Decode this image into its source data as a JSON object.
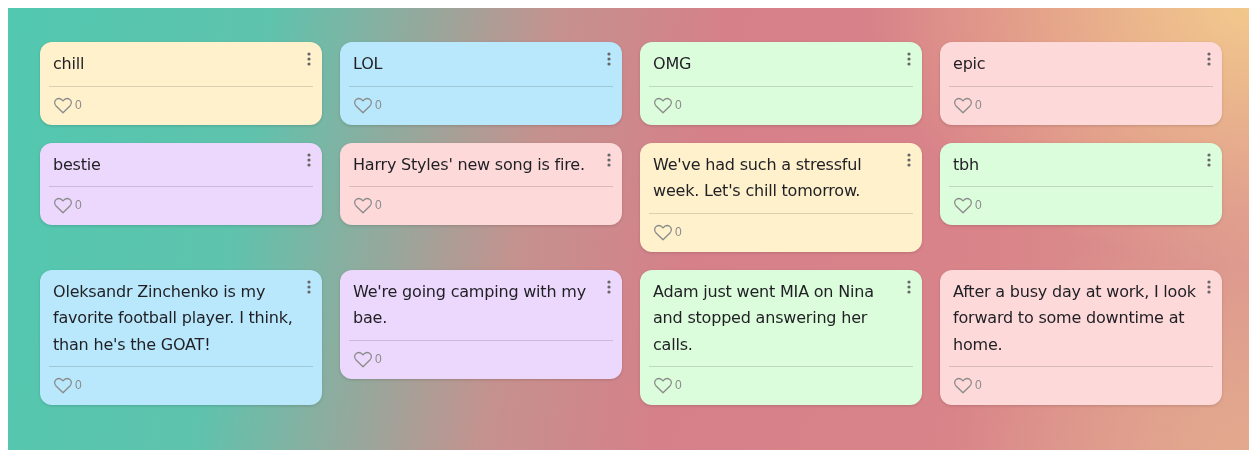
{
  "cards": [
    {
      "text": "chill",
      "color": "#fef1cc",
      "likes": "0"
    },
    {
      "text": "LOL",
      "color": "#b9e8fc",
      "likes": "0"
    },
    {
      "text": "OMG",
      "color": "#dcfddc",
      "likes": "0"
    },
    {
      "text": "epic",
      "color": "#fdd9da",
      "likes": "0"
    },
    {
      "text": "bestie",
      "color": "#edd8fd",
      "likes": "0"
    },
    {
      "text": "Harry Styles' new song is fire.",
      "color": "#fdd9da",
      "likes": "0"
    },
    {
      "text": "We've had such a stressful week. Let's chill tomorrow.",
      "color": "#fef1cc",
      "likes": "0"
    },
    {
      "text": "tbh",
      "color": "#dcfddc",
      "likes": "0"
    },
    {
      "text": "Oleksandr Zinchenko is my favorite football player. I think, than he's the GOAT!",
      "color": "#b9e8fc",
      "likes": "0"
    },
    {
      "text": "We're going camping with my bae.",
      "color": "#edd8fd",
      "likes": "0"
    },
    {
      "text": "Adam just went MIA on Nina and stopped answering her calls.",
      "color": "#dcfddc",
      "likes": "0"
    },
    {
      "text": "After a busy day at work, I look forward to some downtime at home.",
      "color": "#fdd9da",
      "likes": "0"
    }
  ]
}
